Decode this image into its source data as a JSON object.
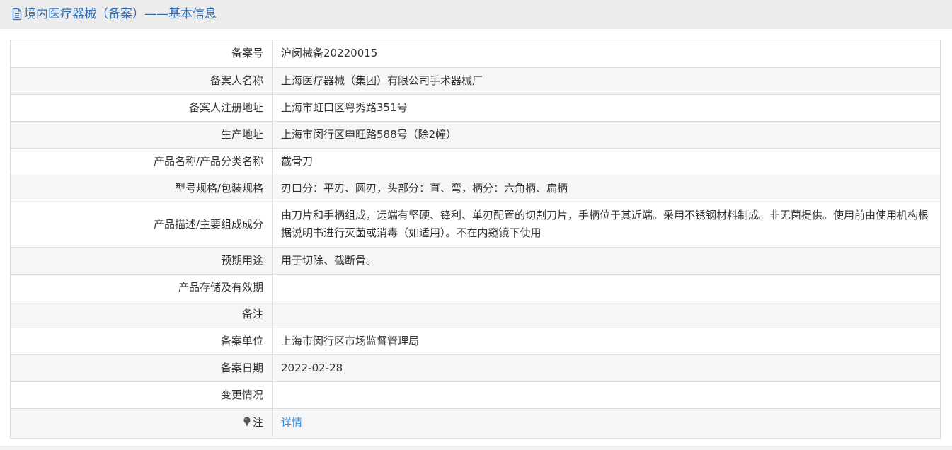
{
  "header": {
    "title": "境内医疗器械（备案）——基本信息",
    "icon": "document-icon",
    "color": "#2a6db5"
  },
  "rows": [
    {
      "label": "备案号",
      "value": "沪闵械备20220015"
    },
    {
      "label": "备案人名称",
      "value": "上海医疗器械（集团）有限公司手术器械厂"
    },
    {
      "label": "备案人注册地址",
      "value": "上海市虹口区粤秀路351号"
    },
    {
      "label": "生产地址",
      "value": "上海市闵行区申旺路588号（除2幢）"
    },
    {
      "label": "产品名称/产品分类名称",
      "value": "截骨刀"
    },
    {
      "label": "型号规格/包装规格",
      "value": "刃口分：平刃、圆刃，头部分：直、弯，柄分：六角柄、扁柄"
    },
    {
      "label": "产品描述/主要组成成分",
      "value": "由刀片和手柄组成，远端有坚硬、锋利、单刃配置的切割刀片，手柄位于其近端。采用不锈钢材料制成。非无菌提供。使用前由使用机构根据说明书进行灭菌或消毒（如适用）。不在内窥镜下使用"
    },
    {
      "label": "预期用途",
      "value": "用于切除、截断骨。"
    },
    {
      "label": "产品存储及有效期",
      "value": ""
    },
    {
      "label": "备注",
      "value": ""
    },
    {
      "label": "备案单位",
      "value": "上海市闵行区市场监督管理局"
    },
    {
      "label": "备案日期",
      "value": "2022-02-28"
    },
    {
      "label": "变更情况",
      "value": ""
    }
  ],
  "note": {
    "label": "注",
    "icon": "pin-icon",
    "link_text": "详情",
    "link_color": "#3a8bd0"
  }
}
